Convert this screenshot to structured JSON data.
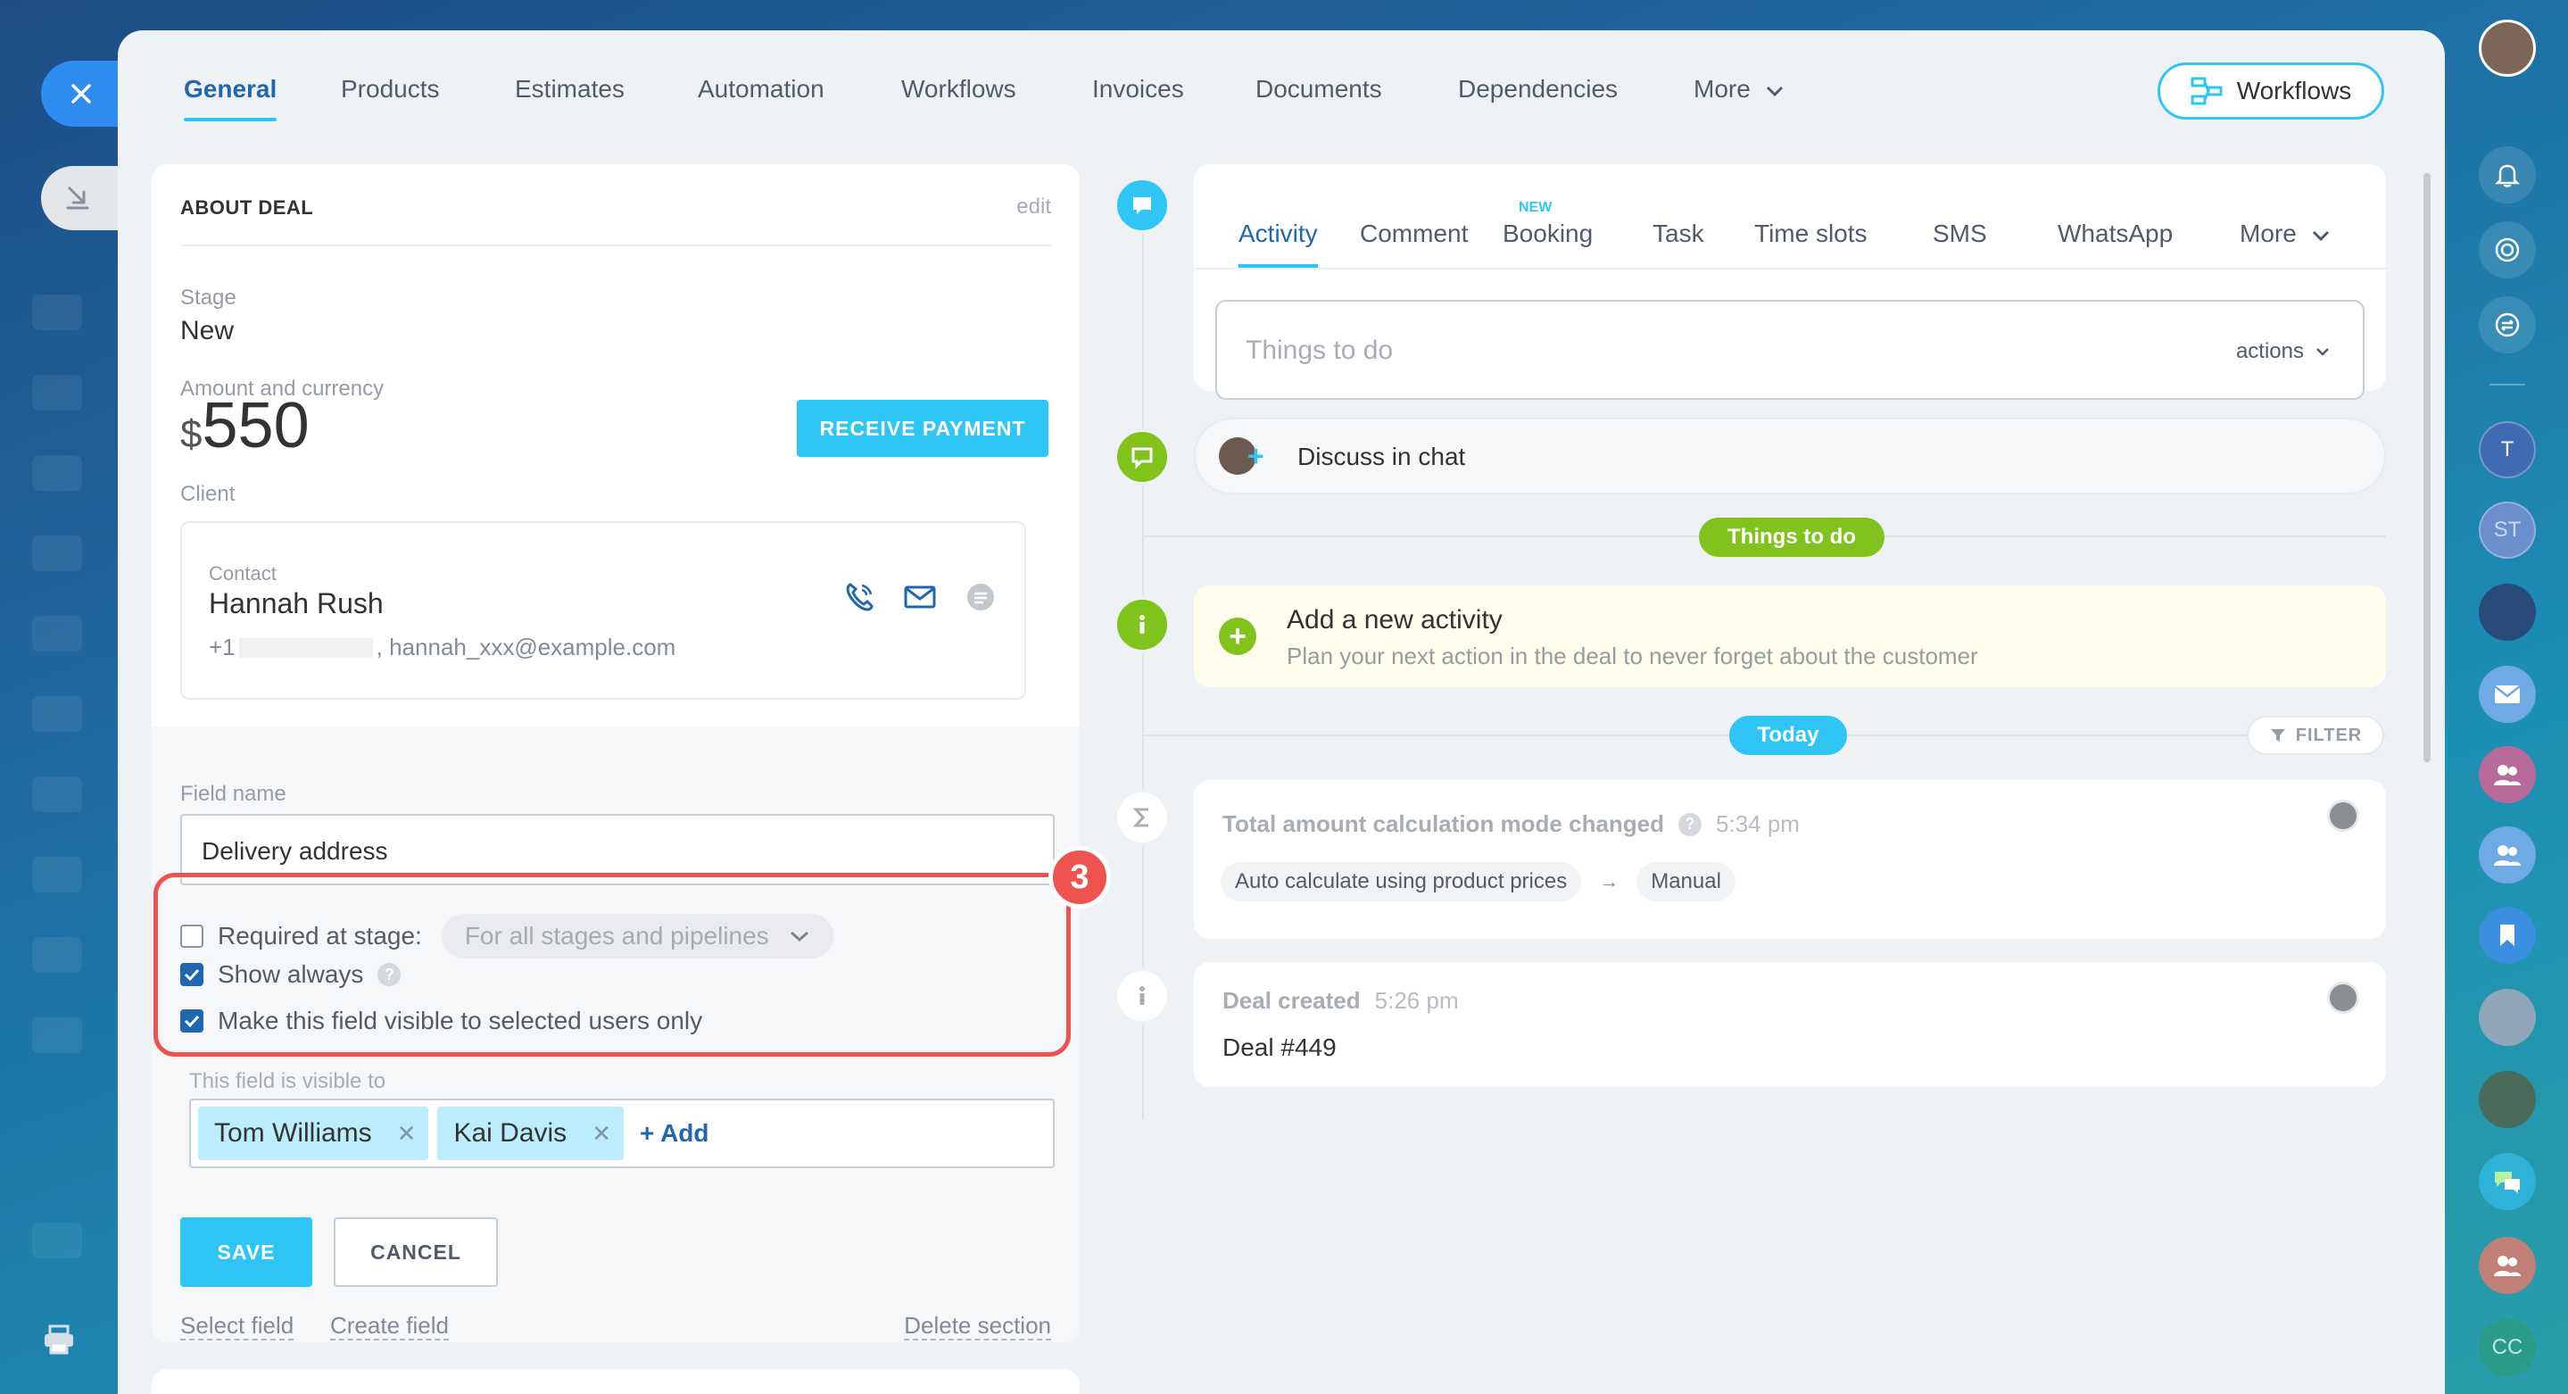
{
  "top_tabs": [
    "General",
    "Products",
    "Estimates",
    "Automation",
    "Workflows",
    "Invoices",
    "Documents",
    "Dependencies",
    "More"
  ],
  "workflows_button": "Workflows",
  "about": {
    "title": "ABOUT DEAL",
    "edit": "edit",
    "stage_label": "Stage",
    "stage_value": "New",
    "amount_label": "Amount and currency",
    "currency_symbol": "$",
    "amount": "550",
    "receive_payment": "RECEIVE PAYMENT",
    "client_label": "Client",
    "contact_type": "Contact",
    "contact_name": "Hannah Rush",
    "phone_prefix": "+1",
    "email": ", hannah_xxx@example.com"
  },
  "field_editor": {
    "field_name_label": "Field name",
    "field_name_value": "Delivery address",
    "required_label": "Required at stage:",
    "required_checked": false,
    "stages_select": "For all stages and pipelines",
    "show_always_label": "Show always",
    "show_always_checked": true,
    "visible_selected_label": "Make this field visible to selected users only",
    "visible_selected_checked": true,
    "visible_to_label": "This field is visible to",
    "users": [
      "Tom Williams",
      "Kai Davis"
    ],
    "add_label": "+ Add",
    "step_number": "3",
    "save": "SAVE",
    "cancel": "CANCEL",
    "select_field": "Select field",
    "create_field": "Create field",
    "delete_section": "Delete section"
  },
  "activity": {
    "tabs": [
      "Activity",
      "Comment",
      "Booking",
      "Task",
      "Time slots",
      "SMS",
      "WhatsApp",
      "More"
    ],
    "new_badge": "NEW",
    "todo_placeholder": "Things to do",
    "actions_label": "actions",
    "discuss_chat": "Discuss in chat",
    "things_to_do_pill": "Things to do",
    "new_activity_title": "Add a new activity",
    "new_activity_sub": "Plan your next action in the deal to never forget about the customer",
    "today_pill": "Today",
    "filter": "FILTER"
  },
  "events": [
    {
      "title": "Total amount calculation mode changed",
      "time": "5:34 pm",
      "from": "Auto calculate using product prices",
      "arrow": "→",
      "to": "Manual"
    },
    {
      "title": "Deal created",
      "time": "5:26 pm",
      "body": "Deal #449"
    }
  ],
  "right_rail": {
    "initials_t": "T",
    "initials_st": "ST",
    "initials_cc": "CC"
  },
  "colors": {
    "accent": "#2fc6f6",
    "link": "#2067b0",
    "green": "#7fc31c",
    "highlight": "#ef5350"
  }
}
